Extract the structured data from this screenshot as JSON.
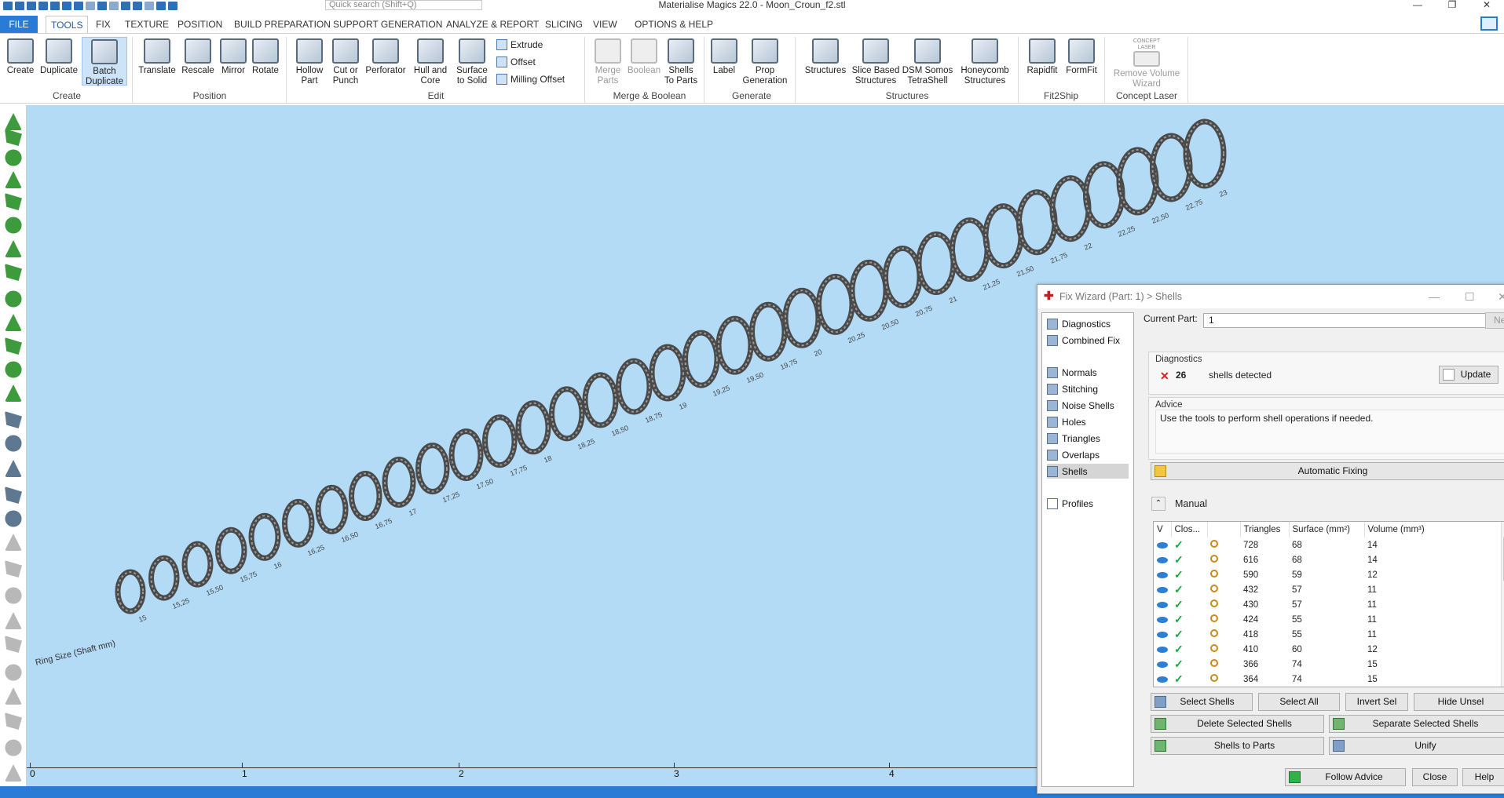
{
  "window": {
    "title": "Materialise Magics 22.0 - Moon_Croun_f2.stl",
    "quick_search_placeholder": "Quick search (Shift+Q)"
  },
  "tabs": [
    "FILE",
    "TOOLS",
    "FIX",
    "TEXTURE",
    "POSITION",
    "BUILD PREPARATION",
    "SUPPORT GENERATION",
    "ANALYZE & REPORT",
    "SLICING",
    "VIEW",
    "OPTIONS & HELP"
  ],
  "ribbon": {
    "create": {
      "create": "Create",
      "duplicate": "Duplicate",
      "batch": "Batch Duplicate",
      "group": "Create"
    },
    "position": {
      "translate": "Translate",
      "rescale": "Rescale",
      "mirror": "Mirror",
      "rotate": "Rotate",
      "group": "Position"
    },
    "edit": {
      "hollow": "Hollow Part",
      "cut": "Cut or Punch",
      "perforator": "Perforator",
      "hull": "Hull and Core",
      "surface": "Surface to Solid",
      "extrude": "Extrude",
      "offset": "Offset",
      "milling": "Milling Offset",
      "group": "Edit"
    },
    "merge": {
      "merge": "Merge Parts",
      "boolean": "Boolean",
      "shells": "Shells To Parts",
      "group": "Merge & Boolean"
    },
    "generate": {
      "label": "Label",
      "prop": "Prop Generation",
      "group": "Generate"
    },
    "structures": {
      "structures": "Structures",
      "slice": "Slice Based Structures",
      "dsm": "DSM Somos TetraShell",
      "honeycomb": "Honeycomb Structures",
      "group": "Structures"
    },
    "fit2ship": {
      "rapidfit": "Rapidfit",
      "formfit": "FormFit",
      "group": "Fit2Ship"
    },
    "concept": {
      "brand": "CONCEPT LASER",
      "remove": "Remove Volume Wizard",
      "group": "Concept Laser"
    }
  },
  "viewport": {
    "ruler_ticks": [
      "0",
      "1",
      "2",
      "3",
      "4"
    ],
    "ring_labels": [
      "15",
      "15,25",
      "15,50",
      "15,75",
      "16",
      "16,25",
      "16,50",
      "16,75",
      "17",
      "17,25",
      "17,50",
      "17,75",
      "18",
      "18,25",
      "18,50",
      "18,75",
      "19",
      "19,25",
      "19,50",
      "19,75",
      "20",
      "20,25",
      "20,50",
      "20,75",
      "21",
      "21,25",
      "21,50",
      "21,75",
      "22",
      "22,25",
      "22,50",
      "22,75",
      "23"
    ],
    "start_label": "Ring Size (Shaft mm)"
  },
  "wizard": {
    "title": "Fix Wizard (Part: 1) > Shells",
    "nav": [
      "Diagnostics",
      "Combined Fix",
      "Normals",
      "Stitching",
      "Noise Shells",
      "Holes",
      "Triangles",
      "Overlaps",
      "Shells",
      "Profiles"
    ],
    "current_part_label": "Current Part:",
    "current_part_value": "1",
    "next_label": "Nex",
    "diagnostics_title": "Diagnostics",
    "shell_count": "26",
    "shells_text": "shells detected",
    "update_label": "Update",
    "advice_title": "Advice",
    "advice_text": "Use the tools to perform shell operations if needed.",
    "automatic_fixing": "Automatic Fixing",
    "manual_title": "Manual",
    "columns": [
      "V",
      "Clos...",
      "",
      "Triangles",
      "Surface (mm²)",
      "Volume (mm³)"
    ],
    "rows": [
      {
        "triangles": "728",
        "surface": "68",
        "volume": "14"
      },
      {
        "triangles": "616",
        "surface": "68",
        "volume": "14"
      },
      {
        "triangles": "590",
        "surface": "59",
        "volume": "12"
      },
      {
        "triangles": "432",
        "surface": "57",
        "volume": "11"
      },
      {
        "triangles": "430",
        "surface": "57",
        "volume": "11"
      },
      {
        "triangles": "424",
        "surface": "55",
        "volume": "11"
      },
      {
        "triangles": "418",
        "surface": "55",
        "volume": "11"
      },
      {
        "triangles": "410",
        "surface": "60",
        "volume": "12"
      },
      {
        "triangles": "366",
        "surface": "74",
        "volume": "15"
      },
      {
        "triangles": "364",
        "surface": "74",
        "volume": "15"
      }
    ],
    "buttons": {
      "select_shells": "Select Shells",
      "select_all": "Select All",
      "invert_sel": "Invert Sel",
      "hide_unsel": "Hide Unsel",
      "delete_selected": "Delete Selected Shells",
      "separate_selected": "Separate Selected Shells",
      "shells_to_parts": "Shells to Parts",
      "unify": "Unify",
      "follow_advice": "Follow Advice",
      "close": "Close",
      "help": "Help"
    }
  },
  "colors": {
    "viewport_bg": "#b3dbf6",
    "accent": "#2a7bd6",
    "ok_green": "#15a83a",
    "error_red": "#d02020"
  }
}
